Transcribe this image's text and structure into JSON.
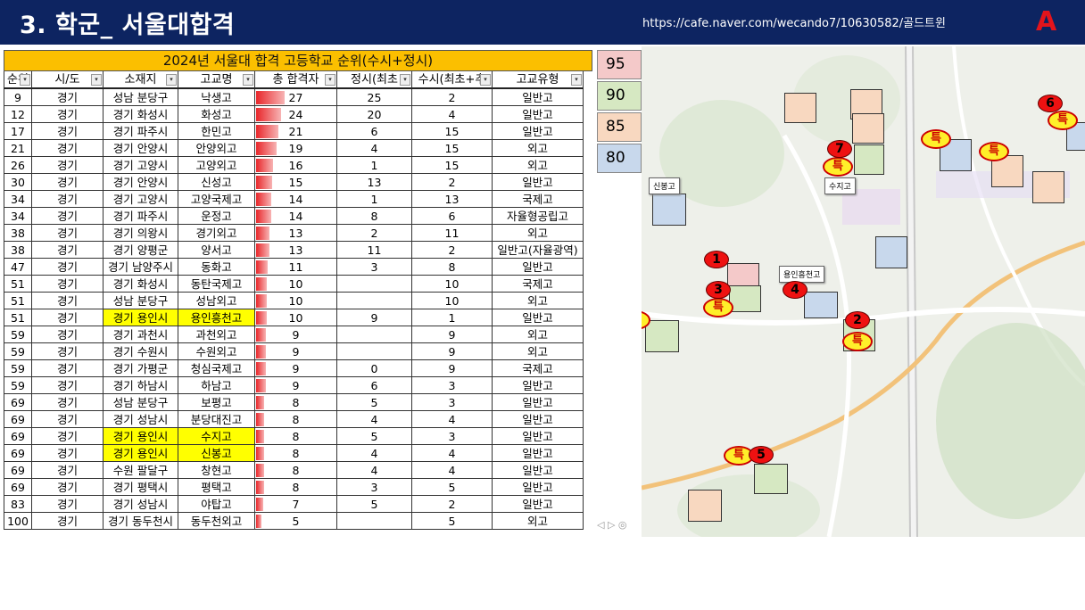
{
  "header": {
    "title": "3. 학군_ 서울대합격",
    "url": "https://cafe.naver.com/wecando7/10630582/골드트윈",
    "logo": "A"
  },
  "sheet": {
    "banner": "2024년 서울대 합격 고등학교 순위(수시+정시)",
    "columns": [
      "순위",
      "시/도",
      "소재지",
      "고교명",
      "총 합격자",
      "정시(최초",
      "수시(최초+추",
      "고교유형"
    ],
    "rows": [
      [
        "9",
        "경기",
        "성남 분당구",
        "낙생고",
        "27",
        "25",
        "2",
        "일반고"
      ],
      [
        "12",
        "경기",
        "경기 화성시",
        "화성고",
        "24",
        "20",
        "4",
        "일반고"
      ],
      [
        "17",
        "경기",
        "경기 파주시",
        "한민고",
        "21",
        "6",
        "15",
        "일반고"
      ],
      [
        "21",
        "경기",
        "경기 안양시",
        "안양외고",
        "19",
        "4",
        "15",
        "외고"
      ],
      [
        "26",
        "경기",
        "경기 고양시",
        "고양외고",
        "16",
        "1",
        "15",
        "외고"
      ],
      [
        "30",
        "경기",
        "경기 안양시",
        "신성고",
        "15",
        "13",
        "2",
        "일반고"
      ],
      [
        "34",
        "경기",
        "경기 고양시",
        "고양국제고",
        "14",
        "1",
        "13",
        "국제고"
      ],
      [
        "34",
        "경기",
        "경기 파주시",
        "운정고",
        "14",
        "8",
        "6",
        "자율형공립고"
      ],
      [
        "38",
        "경기",
        "경기 의왕시",
        "경기외고",
        "13",
        "2",
        "11",
        "외고"
      ],
      [
        "38",
        "경기",
        "경기 양평군",
        "양서고",
        "13",
        "11",
        "2",
        "일반고(자율광역)"
      ],
      [
        "47",
        "경기",
        "경기 남양주시",
        "동화고",
        "11",
        "3",
        "8",
        "일반고"
      ],
      [
        "51",
        "경기",
        "경기 화성시",
        "동탄국제고",
        "10",
        "",
        "10",
        "국제고"
      ],
      [
        "51",
        "경기",
        "성남 분당구",
        "성남외고",
        "10",
        "",
        "10",
        "외고"
      ],
      [
        "51",
        "경기",
        "경기 용인시",
        "용인흥천고",
        "10",
        "9",
        "1",
        "일반고"
      ],
      [
        "59",
        "경기",
        "경기 과천시",
        "과천외고",
        "9",
        "",
        "9",
        "외고"
      ],
      [
        "59",
        "경기",
        "경기 수원시",
        "수원외고",
        "9",
        "",
        "9",
        "외고"
      ],
      [
        "59",
        "경기",
        "경기 가평군",
        "청심국제고",
        "9",
        "0",
        "9",
        "국제고"
      ],
      [
        "59",
        "경기",
        "경기 하남시",
        "하남고",
        "9",
        "6",
        "3",
        "일반고"
      ],
      [
        "69",
        "경기",
        "성남 분당구",
        "보평고",
        "8",
        "5",
        "3",
        "일반고"
      ],
      [
        "69",
        "경기",
        "경기 성남시",
        "분당대진고",
        "8",
        "4",
        "4",
        "일반고"
      ],
      [
        "69",
        "경기",
        "경기 용인시",
        "수지고",
        "8",
        "5",
        "3",
        "일반고"
      ],
      [
        "69",
        "경기",
        "경기 용인시",
        "신봉고",
        "8",
        "4",
        "4",
        "일반고"
      ],
      [
        "69",
        "경기",
        "수원 팔달구",
        "창현고",
        "8",
        "4",
        "4",
        "일반고"
      ],
      [
        "69",
        "경기",
        "경기 평택시",
        "평택고",
        "8",
        "3",
        "5",
        "일반고"
      ],
      [
        "83",
        "경기",
        "경기 성남시",
        "야탑고",
        "7",
        "5",
        "2",
        "일반고"
      ],
      [
        "100",
        "경기",
        "경기 동두천시",
        "동두천외고",
        "5",
        "",
        "5",
        "외고"
      ]
    ],
    "highlighted_rows": [
      13,
      20,
      21
    ]
  },
  "legend": [
    {
      "label": "95",
      "color": "#f4c9c9"
    },
    {
      "label": "90",
      "color": "#d6e8c2"
    },
    {
      "label": "85",
      "color": "#f8d8c0"
    },
    {
      "label": "80",
      "color": "#c8d8ec"
    }
  ],
  "map": {
    "labels": [
      "신봉고",
      "수지고",
      "용인흥천고"
    ],
    "markers": [
      "1",
      "2",
      "3",
      "4",
      "5",
      "6",
      "7"
    ],
    "special": "특"
  },
  "colors": {
    "header_bg": "#0d2461",
    "banner": "#fbbf00",
    "highlight": "#ffff00",
    "bar": "#e8262a"
  }
}
